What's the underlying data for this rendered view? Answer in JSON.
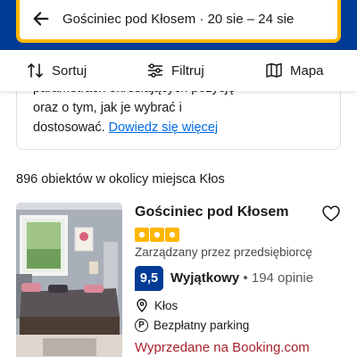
{
  "header": {
    "search_text": "Gościniec pod Kłosem · 20 sie – 24 sie",
    "back_icon": "arrow-left-icon",
    "brand_color": "#003b95",
    "highlight_color": "#ffb700"
  },
  "toolbar": {
    "sort_label": "Sortuj",
    "filter_label": "Filtruj",
    "map_label": "Mapa"
  },
  "info": {
    "partial_line": "parametrach określających pozycję",
    "line2": "oraz o tym, jak je wybrać i",
    "line3": "dostosować.",
    "link": "Dowiedz się więcej"
  },
  "results": {
    "count_text": "896 obiektów w okolicy miejsca Kłos"
  },
  "listing": {
    "name": "Gościniec pod Kłosem",
    "stars": 3,
    "managed_by": "Zarządzany przez przedsiębiorcę",
    "score": "9,5",
    "score_label": "Wyjątkowy",
    "separator": "•",
    "reviews": "194 opinie",
    "location": "Kłos",
    "parking_letter": "P",
    "parking": "Bezpłatny parking",
    "availability": "Wyprzedane na Booking.com"
  }
}
